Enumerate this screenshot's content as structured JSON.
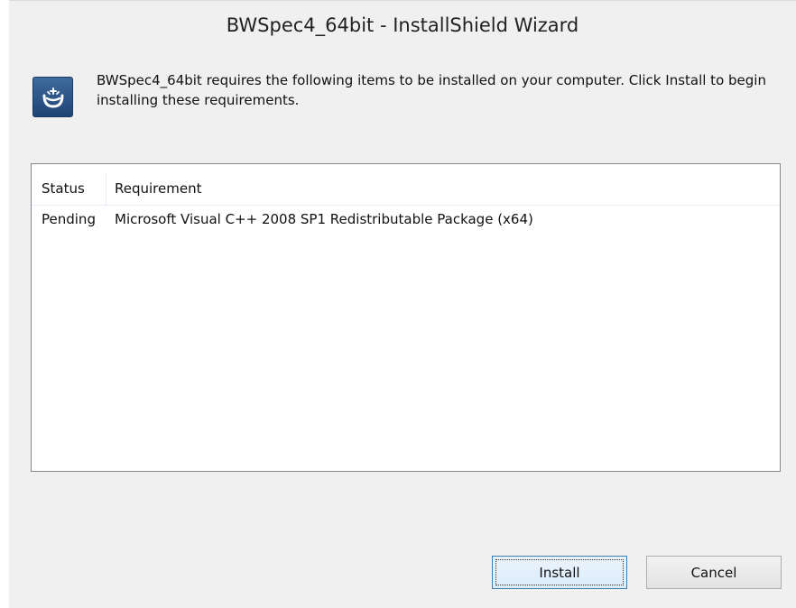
{
  "window": {
    "title": "BWSpec4_64bit - InstallShield Wizard"
  },
  "header": {
    "icon": "installshield-icon",
    "message": "BWSpec4_64bit requires the following items to be installed on your computer. Click Install to begin installing these requirements."
  },
  "requirements_list": {
    "columns": [
      "Status",
      "Requirement"
    ],
    "rows": [
      {
        "status": "Pending",
        "requirement": "Microsoft Visual C++ 2008 SP1 Redistributable Package (x64)"
      }
    ]
  },
  "buttons": {
    "install_label": "Install",
    "cancel_label": "Cancel"
  },
  "colors": {
    "dialog_background": "#f0f0f0",
    "list_background": "#ffffff",
    "icon_blue": "#1f4474",
    "default_button_border": "#3c7fb1"
  }
}
